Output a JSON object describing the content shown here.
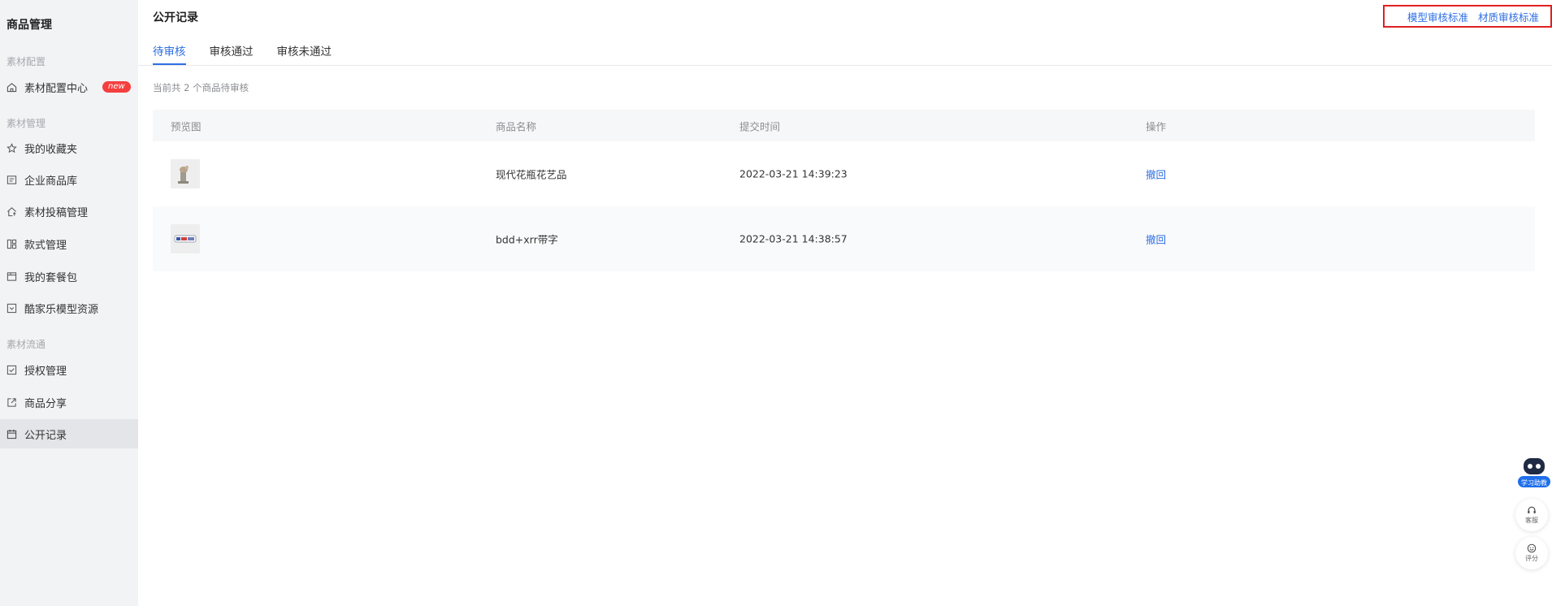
{
  "sidebar": {
    "title": "商品管理",
    "groups": [
      "素材配置",
      "素材管理",
      "素材流通"
    ],
    "items": [
      {
        "label": "素材配置中心",
        "badge": "new"
      },
      {
        "label": "我的收藏夹"
      },
      {
        "label": "企业商品库"
      },
      {
        "label": "素材投稿管理"
      },
      {
        "label": "款式管理"
      },
      {
        "label": "我的套餐包"
      },
      {
        "label": "酷家乐模型资源"
      },
      {
        "label": "授权管理"
      },
      {
        "label": "商品分享"
      },
      {
        "label": "公开记录"
      }
    ]
  },
  "header": {
    "title": "公开记录",
    "links": [
      "模型审核标准",
      "材质审核标准"
    ]
  },
  "tabs": [
    "待审核",
    "审核通过",
    "审核未通过"
  ],
  "summary": "当前共 2 个商品待审核",
  "table": {
    "columns": [
      "预览图",
      "商品名称",
      "提交时间",
      "操作"
    ],
    "rows": [
      {
        "name": "现代花瓶花艺品",
        "time": "2022-03-21 14:39:23",
        "action": "撤回"
      },
      {
        "name": "bdd+xrr带字",
        "time": "2022-03-21 14:38:57",
        "action": "撤回"
      }
    ]
  },
  "floating": {
    "assistant_label": "学习助教",
    "service_label": "客服",
    "rate_label": "评分"
  },
  "colors": {
    "accent": "#2f6fe4",
    "badge": "#f53f3f",
    "highlight_border": "#e02020",
    "sidebar_bg": "#f2f3f5"
  }
}
